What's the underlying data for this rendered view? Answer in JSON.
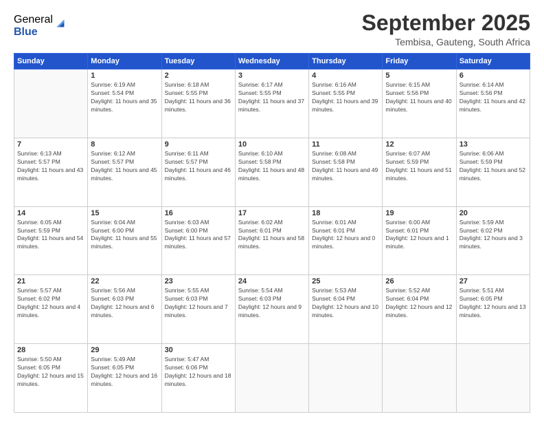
{
  "logo": {
    "general": "General",
    "blue": "Blue"
  },
  "title": "September 2025",
  "location": "Tembisa, Gauteng, South Africa",
  "weekdays": [
    "Sunday",
    "Monday",
    "Tuesday",
    "Wednesday",
    "Thursday",
    "Friday",
    "Saturday"
  ],
  "weeks": [
    [
      {
        "day": "",
        "sunrise": "",
        "sunset": "",
        "daylight": ""
      },
      {
        "day": "1",
        "sunrise": "Sunrise: 6:19 AM",
        "sunset": "Sunset: 5:54 PM",
        "daylight": "Daylight: 11 hours and 35 minutes."
      },
      {
        "day": "2",
        "sunrise": "Sunrise: 6:18 AM",
        "sunset": "Sunset: 5:55 PM",
        "daylight": "Daylight: 11 hours and 36 minutes."
      },
      {
        "day": "3",
        "sunrise": "Sunrise: 6:17 AM",
        "sunset": "Sunset: 5:55 PM",
        "daylight": "Daylight: 11 hours and 37 minutes."
      },
      {
        "day": "4",
        "sunrise": "Sunrise: 6:16 AM",
        "sunset": "Sunset: 5:55 PM",
        "daylight": "Daylight: 11 hours and 39 minutes."
      },
      {
        "day": "5",
        "sunrise": "Sunrise: 6:15 AM",
        "sunset": "Sunset: 5:56 PM",
        "daylight": "Daylight: 11 hours and 40 minutes."
      },
      {
        "day": "6",
        "sunrise": "Sunrise: 6:14 AM",
        "sunset": "Sunset: 5:56 PM",
        "daylight": "Daylight: 11 hours and 42 minutes."
      }
    ],
    [
      {
        "day": "7",
        "sunrise": "Sunrise: 6:13 AM",
        "sunset": "Sunset: 5:57 PM",
        "daylight": "Daylight: 11 hours and 43 minutes."
      },
      {
        "day": "8",
        "sunrise": "Sunrise: 6:12 AM",
        "sunset": "Sunset: 5:57 PM",
        "daylight": "Daylight: 11 hours and 45 minutes."
      },
      {
        "day": "9",
        "sunrise": "Sunrise: 6:11 AM",
        "sunset": "Sunset: 5:57 PM",
        "daylight": "Daylight: 11 hours and 46 minutes."
      },
      {
        "day": "10",
        "sunrise": "Sunrise: 6:10 AM",
        "sunset": "Sunset: 5:58 PM",
        "daylight": "Daylight: 11 hours and 48 minutes."
      },
      {
        "day": "11",
        "sunrise": "Sunrise: 6:08 AM",
        "sunset": "Sunset: 5:58 PM",
        "daylight": "Daylight: 11 hours and 49 minutes."
      },
      {
        "day": "12",
        "sunrise": "Sunrise: 6:07 AM",
        "sunset": "Sunset: 5:59 PM",
        "daylight": "Daylight: 11 hours and 51 minutes."
      },
      {
        "day": "13",
        "sunrise": "Sunrise: 6:06 AM",
        "sunset": "Sunset: 5:59 PM",
        "daylight": "Daylight: 11 hours and 52 minutes."
      }
    ],
    [
      {
        "day": "14",
        "sunrise": "Sunrise: 6:05 AM",
        "sunset": "Sunset: 5:59 PM",
        "daylight": "Daylight: 11 hours and 54 minutes."
      },
      {
        "day": "15",
        "sunrise": "Sunrise: 6:04 AM",
        "sunset": "Sunset: 6:00 PM",
        "daylight": "Daylight: 11 hours and 55 minutes."
      },
      {
        "day": "16",
        "sunrise": "Sunrise: 6:03 AM",
        "sunset": "Sunset: 6:00 PM",
        "daylight": "Daylight: 11 hours and 57 minutes."
      },
      {
        "day": "17",
        "sunrise": "Sunrise: 6:02 AM",
        "sunset": "Sunset: 6:01 PM",
        "daylight": "Daylight: 11 hours and 58 minutes."
      },
      {
        "day": "18",
        "sunrise": "Sunrise: 6:01 AM",
        "sunset": "Sunset: 6:01 PM",
        "daylight": "Daylight: 12 hours and 0 minutes."
      },
      {
        "day": "19",
        "sunrise": "Sunrise: 6:00 AM",
        "sunset": "Sunset: 6:01 PM",
        "daylight": "Daylight: 12 hours and 1 minute."
      },
      {
        "day": "20",
        "sunrise": "Sunrise: 5:59 AM",
        "sunset": "Sunset: 6:02 PM",
        "daylight": "Daylight: 12 hours and 3 minutes."
      }
    ],
    [
      {
        "day": "21",
        "sunrise": "Sunrise: 5:57 AM",
        "sunset": "Sunset: 6:02 PM",
        "daylight": "Daylight: 12 hours and 4 minutes."
      },
      {
        "day": "22",
        "sunrise": "Sunrise: 5:56 AM",
        "sunset": "Sunset: 6:03 PM",
        "daylight": "Daylight: 12 hours and 6 minutes."
      },
      {
        "day": "23",
        "sunrise": "Sunrise: 5:55 AM",
        "sunset": "Sunset: 6:03 PM",
        "daylight": "Daylight: 12 hours and 7 minutes."
      },
      {
        "day": "24",
        "sunrise": "Sunrise: 5:54 AM",
        "sunset": "Sunset: 6:03 PM",
        "daylight": "Daylight: 12 hours and 9 minutes."
      },
      {
        "day": "25",
        "sunrise": "Sunrise: 5:53 AM",
        "sunset": "Sunset: 6:04 PM",
        "daylight": "Daylight: 12 hours and 10 minutes."
      },
      {
        "day": "26",
        "sunrise": "Sunrise: 5:52 AM",
        "sunset": "Sunset: 6:04 PM",
        "daylight": "Daylight: 12 hours and 12 minutes."
      },
      {
        "day": "27",
        "sunrise": "Sunrise: 5:51 AM",
        "sunset": "Sunset: 6:05 PM",
        "daylight": "Daylight: 12 hours and 13 minutes."
      }
    ],
    [
      {
        "day": "28",
        "sunrise": "Sunrise: 5:50 AM",
        "sunset": "Sunset: 6:05 PM",
        "daylight": "Daylight: 12 hours and 15 minutes."
      },
      {
        "day": "29",
        "sunrise": "Sunrise: 5:49 AM",
        "sunset": "Sunset: 6:05 PM",
        "daylight": "Daylight: 12 hours and 16 minutes."
      },
      {
        "day": "30",
        "sunrise": "Sunrise: 5:47 AM",
        "sunset": "Sunset: 6:06 PM",
        "daylight": "Daylight: 12 hours and 18 minutes."
      },
      {
        "day": "",
        "sunrise": "",
        "sunset": "",
        "daylight": ""
      },
      {
        "day": "",
        "sunrise": "",
        "sunset": "",
        "daylight": ""
      },
      {
        "day": "",
        "sunrise": "",
        "sunset": "",
        "daylight": ""
      },
      {
        "day": "",
        "sunrise": "",
        "sunset": "",
        "daylight": ""
      }
    ]
  ]
}
